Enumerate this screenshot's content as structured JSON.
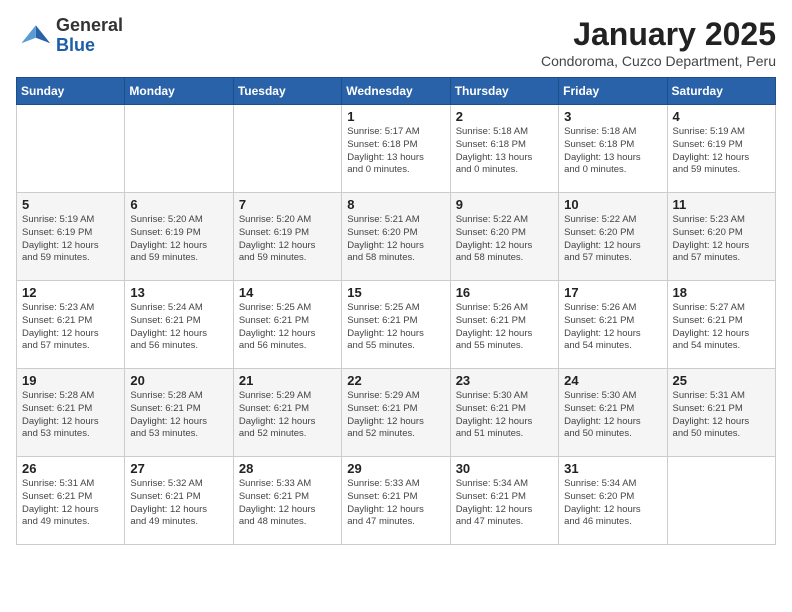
{
  "logo": {
    "general": "General",
    "blue": "Blue"
  },
  "title": "January 2025",
  "subtitle": "Condoroma, Cuzco Department, Peru",
  "weekdays": [
    "Sunday",
    "Monday",
    "Tuesday",
    "Wednesday",
    "Thursday",
    "Friday",
    "Saturday"
  ],
  "weeks": [
    [
      {
        "day": "",
        "info": ""
      },
      {
        "day": "",
        "info": ""
      },
      {
        "day": "",
        "info": ""
      },
      {
        "day": "1",
        "info": "Sunrise: 5:17 AM\nSunset: 6:18 PM\nDaylight: 13 hours\nand 0 minutes."
      },
      {
        "day": "2",
        "info": "Sunrise: 5:18 AM\nSunset: 6:18 PM\nDaylight: 13 hours\nand 0 minutes."
      },
      {
        "day": "3",
        "info": "Sunrise: 5:18 AM\nSunset: 6:18 PM\nDaylight: 13 hours\nand 0 minutes."
      },
      {
        "day": "4",
        "info": "Sunrise: 5:19 AM\nSunset: 6:19 PM\nDaylight: 12 hours\nand 59 minutes."
      }
    ],
    [
      {
        "day": "5",
        "info": "Sunrise: 5:19 AM\nSunset: 6:19 PM\nDaylight: 12 hours\nand 59 minutes."
      },
      {
        "day": "6",
        "info": "Sunrise: 5:20 AM\nSunset: 6:19 PM\nDaylight: 12 hours\nand 59 minutes."
      },
      {
        "day": "7",
        "info": "Sunrise: 5:20 AM\nSunset: 6:19 PM\nDaylight: 12 hours\nand 59 minutes."
      },
      {
        "day": "8",
        "info": "Sunrise: 5:21 AM\nSunset: 6:20 PM\nDaylight: 12 hours\nand 58 minutes."
      },
      {
        "day": "9",
        "info": "Sunrise: 5:22 AM\nSunset: 6:20 PM\nDaylight: 12 hours\nand 58 minutes."
      },
      {
        "day": "10",
        "info": "Sunrise: 5:22 AM\nSunset: 6:20 PM\nDaylight: 12 hours\nand 57 minutes."
      },
      {
        "day": "11",
        "info": "Sunrise: 5:23 AM\nSunset: 6:20 PM\nDaylight: 12 hours\nand 57 minutes."
      }
    ],
    [
      {
        "day": "12",
        "info": "Sunrise: 5:23 AM\nSunset: 6:21 PM\nDaylight: 12 hours\nand 57 minutes."
      },
      {
        "day": "13",
        "info": "Sunrise: 5:24 AM\nSunset: 6:21 PM\nDaylight: 12 hours\nand 56 minutes."
      },
      {
        "day": "14",
        "info": "Sunrise: 5:25 AM\nSunset: 6:21 PM\nDaylight: 12 hours\nand 56 minutes."
      },
      {
        "day": "15",
        "info": "Sunrise: 5:25 AM\nSunset: 6:21 PM\nDaylight: 12 hours\nand 55 minutes."
      },
      {
        "day": "16",
        "info": "Sunrise: 5:26 AM\nSunset: 6:21 PM\nDaylight: 12 hours\nand 55 minutes."
      },
      {
        "day": "17",
        "info": "Sunrise: 5:26 AM\nSunset: 6:21 PM\nDaylight: 12 hours\nand 54 minutes."
      },
      {
        "day": "18",
        "info": "Sunrise: 5:27 AM\nSunset: 6:21 PM\nDaylight: 12 hours\nand 54 minutes."
      }
    ],
    [
      {
        "day": "19",
        "info": "Sunrise: 5:28 AM\nSunset: 6:21 PM\nDaylight: 12 hours\nand 53 minutes."
      },
      {
        "day": "20",
        "info": "Sunrise: 5:28 AM\nSunset: 6:21 PM\nDaylight: 12 hours\nand 53 minutes."
      },
      {
        "day": "21",
        "info": "Sunrise: 5:29 AM\nSunset: 6:21 PM\nDaylight: 12 hours\nand 52 minutes."
      },
      {
        "day": "22",
        "info": "Sunrise: 5:29 AM\nSunset: 6:21 PM\nDaylight: 12 hours\nand 52 minutes."
      },
      {
        "day": "23",
        "info": "Sunrise: 5:30 AM\nSunset: 6:21 PM\nDaylight: 12 hours\nand 51 minutes."
      },
      {
        "day": "24",
        "info": "Sunrise: 5:30 AM\nSunset: 6:21 PM\nDaylight: 12 hours\nand 50 minutes."
      },
      {
        "day": "25",
        "info": "Sunrise: 5:31 AM\nSunset: 6:21 PM\nDaylight: 12 hours\nand 50 minutes."
      }
    ],
    [
      {
        "day": "26",
        "info": "Sunrise: 5:31 AM\nSunset: 6:21 PM\nDaylight: 12 hours\nand 49 minutes."
      },
      {
        "day": "27",
        "info": "Sunrise: 5:32 AM\nSunset: 6:21 PM\nDaylight: 12 hours\nand 49 minutes."
      },
      {
        "day": "28",
        "info": "Sunrise: 5:33 AM\nSunset: 6:21 PM\nDaylight: 12 hours\nand 48 minutes."
      },
      {
        "day": "29",
        "info": "Sunrise: 5:33 AM\nSunset: 6:21 PM\nDaylight: 12 hours\nand 47 minutes."
      },
      {
        "day": "30",
        "info": "Sunrise: 5:34 AM\nSunset: 6:21 PM\nDaylight: 12 hours\nand 47 minutes."
      },
      {
        "day": "31",
        "info": "Sunrise: 5:34 AM\nSunset: 6:20 PM\nDaylight: 12 hours\nand 46 minutes."
      },
      {
        "day": "",
        "info": ""
      }
    ]
  ]
}
